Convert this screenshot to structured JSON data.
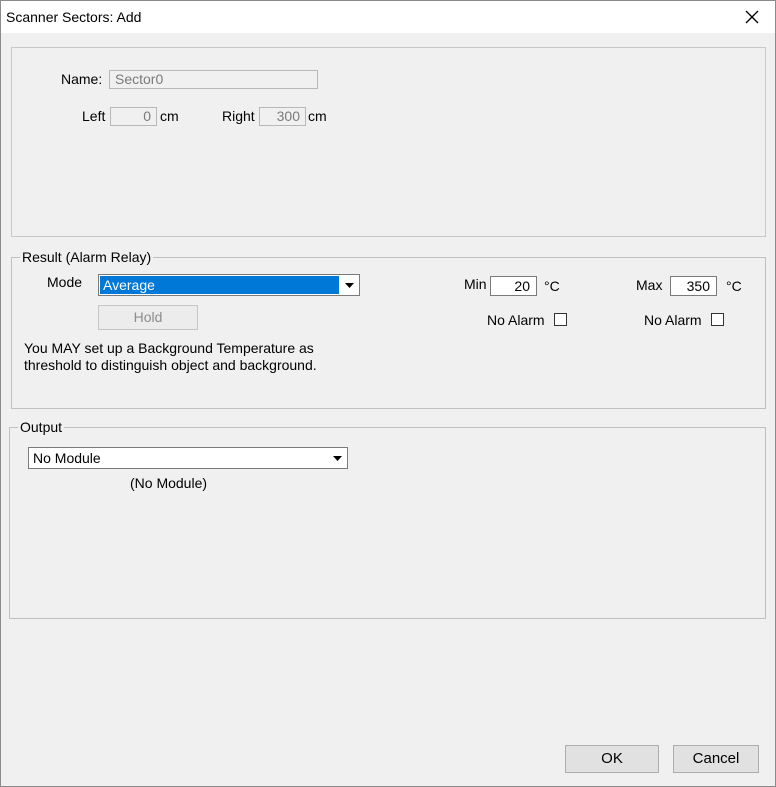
{
  "window": {
    "title": "Scanner Sectors: Add",
    "close_icon": "close-icon"
  },
  "sector": {
    "name_label": "Name:",
    "name_value": "Sector0",
    "left_label": "Left",
    "left_value": "0",
    "left_unit": "cm",
    "right_label": "Right",
    "right_value": "300",
    "right_unit": "cm"
  },
  "result": {
    "group_label": "Result (Alarm Relay)",
    "mode_label": "Mode",
    "mode_value": "Average",
    "hold_label": "Hold",
    "info_line1": "You MAY set up a Background Temperature as",
    "info_line2": "threshold to distinguish object and background.",
    "min_label": "Min",
    "min_value": "20",
    "min_unit": "°C",
    "max_label": "Max",
    "max_value": "350",
    "max_unit": "°C",
    "no_alarm_min_label": "No Alarm",
    "no_alarm_max_label": "No Alarm"
  },
  "output": {
    "group_label": "Output",
    "module_value": "No Module",
    "module_status": "(No Module)"
  },
  "buttons": {
    "ok": "OK",
    "cancel": "Cancel"
  },
  "colors": {
    "selection": "#0078d7",
    "window_bg": "#f0f0f0",
    "titlebar_bg": "#ffffff"
  }
}
